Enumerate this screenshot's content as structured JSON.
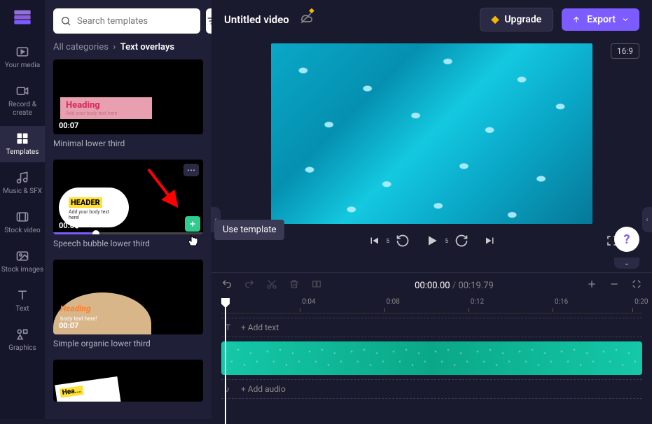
{
  "sidebar": {
    "items": [
      {
        "label": "Your media"
      },
      {
        "label": "Record & create"
      },
      {
        "label": "Templates"
      },
      {
        "label": "Music & SFX"
      },
      {
        "label": "Stock video"
      },
      {
        "label": "Stock images"
      },
      {
        "label": "Text"
      },
      {
        "label": "Graphics"
      }
    ]
  },
  "search": {
    "placeholder": "Search templates"
  },
  "breadcrumb": {
    "root": "All categories",
    "current": "Text overlays"
  },
  "templates": [
    {
      "label": "Minimal lower third",
      "duration": "00:07",
      "heading": "Heading",
      "body": "Add your body text here"
    },
    {
      "label": "Speech bubble lower third",
      "duration": "00:05",
      "heading": "HEADER",
      "body": "Add your body text here!"
    },
    {
      "label": "Simple organic lower third",
      "duration": "00:07",
      "heading": "Heading",
      "body": "body text here!"
    }
  ],
  "header": {
    "title": "Untitled video",
    "upgrade": "Upgrade",
    "export": "Export",
    "aspect": "16:9"
  },
  "tooltip": {
    "use_template": "Use template"
  },
  "timeline": {
    "current": "00:00.00",
    "total": "00:19.79",
    "ticks": [
      "0:04",
      "0:08",
      "0:12",
      "0:16",
      "0:20"
    ],
    "add_text": "+ Add text",
    "add_audio": "+ Add audio"
  }
}
